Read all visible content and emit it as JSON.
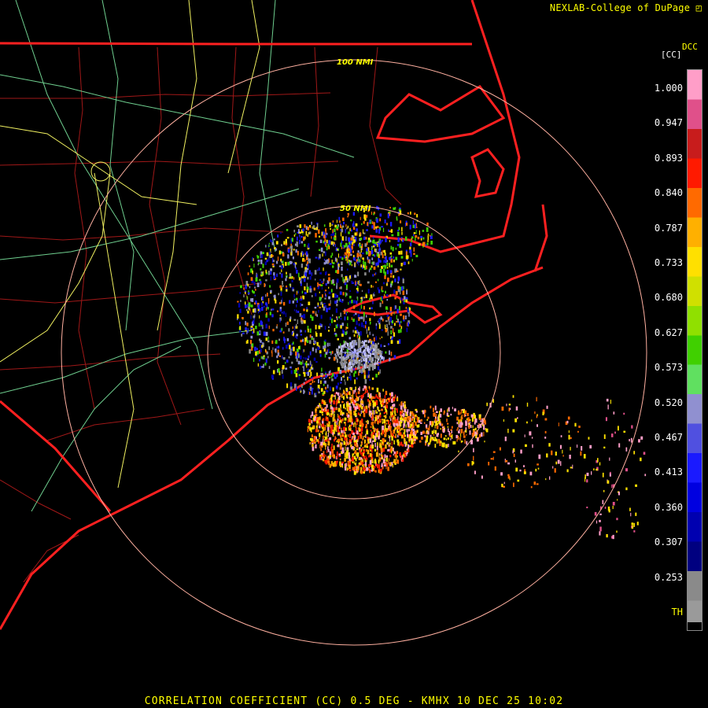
{
  "header": {
    "credit": "NEXLAB-College of DuPage",
    "logo_icon": "cod-logo-icon"
  },
  "legend": {
    "product": "DCC",
    "unit": "[CC]",
    "labels": [
      "1.000",
      "0.947",
      "0.893",
      "0.840",
      "0.787",
      "0.733",
      "0.680",
      "0.627",
      "0.573",
      "0.520",
      "0.467",
      "0.413",
      "0.360",
      "0.307",
      "0.253"
    ],
    "threshold": "TH",
    "colors": [
      "#ff9ec8",
      "#e0508a",
      "#c81c1c",
      "#ff1a00",
      "#ff6a00",
      "#ffb000",
      "#ffe000",
      "#d0e000",
      "#90e000",
      "#40d000",
      "#60e060",
      "#9090d0",
      "#5050e0",
      "#1a1aff",
      "#0000e0",
      "#0000b0",
      "#000080",
      "#8a8a8a",
      "#9a9a9a"
    ]
  },
  "map": {
    "radar_site": "KMHX",
    "rings": [
      {
        "label": "50 NMI"
      },
      {
        "label": "100 NMI"
      }
    ],
    "colors": {
      "state_border": "#ff2020",
      "county": "#a01818",
      "highway_green": "#6fcf8f",
      "highway_yellow": "#f0f060",
      "ring": "#ffb0a0"
    }
  },
  "caption": "CORRELATION COEFFICIENT (CC) 0.5 DEG - KMHX 10 DEC 25 10:02"
}
